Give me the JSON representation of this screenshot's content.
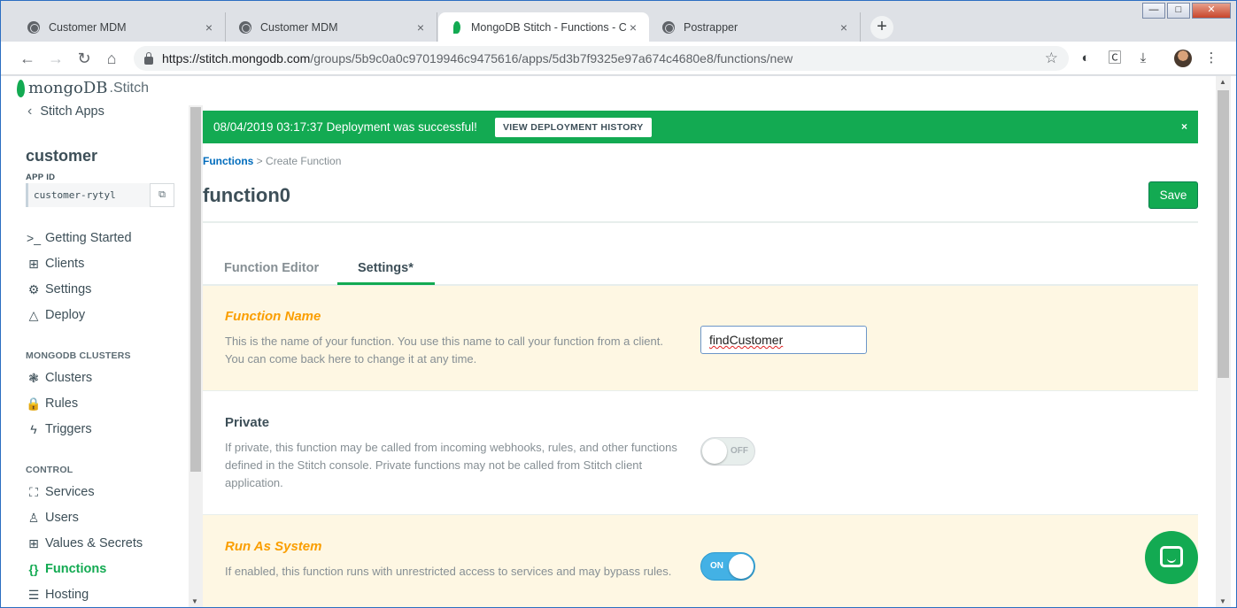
{
  "browser": {
    "tabs": [
      {
        "title": "Customer MDM"
      },
      {
        "title": "Customer MDM"
      },
      {
        "title": "MongoDB Stitch - Functions - Cr"
      },
      {
        "title": "Postrapper"
      }
    ],
    "tab_close": "×",
    "new_tab": "+",
    "window_controls": {
      "minimize": "—",
      "maximize": "□",
      "close": "✕"
    },
    "url_host": "https://stitch.mongodb.com",
    "url_path": "/groups/5b9c0a0c97019946c9475616/apps/5d3b7f9325e97a674c4680e8/functions/new"
  },
  "sidebar": {
    "brand_mongo": "mongoDB",
    "brand_stitch": ".Stitch",
    "back_label": "Stitch Apps",
    "app_name": "customer",
    "app_id_label": "APP ID",
    "app_id": "customer-rytyl",
    "items_top": [
      {
        "label": "Getting Started",
        "icon": ">_"
      },
      {
        "label": "Clients",
        "icon": "⊞"
      },
      {
        "label": "Settings",
        "icon": "⚙"
      },
      {
        "label": "Deploy",
        "icon": "△"
      }
    ],
    "section_clusters": "MONGODB CLUSTERS",
    "items_clusters": [
      {
        "label": "Clusters",
        "icon": "❃"
      },
      {
        "label": "Rules",
        "icon": "🔒"
      },
      {
        "label": "Triggers",
        "icon": "ϟ"
      }
    ],
    "section_control": "CONTROL",
    "items_control": [
      {
        "label": "Services",
        "icon": "⛶"
      },
      {
        "label": "Users",
        "icon": "♙"
      },
      {
        "label": "Values & Secrets",
        "icon": "⊞"
      },
      {
        "label": "Functions",
        "icon": "{}"
      },
      {
        "label": "Hosting",
        "icon": "☰"
      }
    ]
  },
  "banner": {
    "message": "08/04/2019 03:17:37 Deployment was successful!",
    "button": "VIEW DEPLOYMENT HISTORY",
    "close": "×"
  },
  "breadcrumb": {
    "link": "Functions",
    "separator": ">",
    "current": "Create Function"
  },
  "page_title": "function0",
  "save_label": "Save",
  "tabs": [
    {
      "label": "Function Editor"
    },
    {
      "label": "Settings*"
    }
  ],
  "settings": {
    "function_name": {
      "label": "Function Name",
      "desc": "This is the name of your function. You use this name to call your function from a client. You can come back here to change it at any time.",
      "value": "findCustomer"
    },
    "private": {
      "label": "Private",
      "desc": "If private, this function may be called from incoming webhooks, rules, and other functions defined in the Stitch console. Private functions may not be called from Stitch client application.",
      "toggle": "OFF"
    },
    "run_as_system": {
      "label": "Run As System",
      "desc": "If enabled, this function runs with unrestricted access to services and may bypass rules.",
      "toggle": "ON"
    }
  },
  "colors": {
    "brand_green": "#13aa52",
    "warning_label": "#fa9e00",
    "toggle_on": "#43b1e5",
    "link": "#006cbc"
  }
}
